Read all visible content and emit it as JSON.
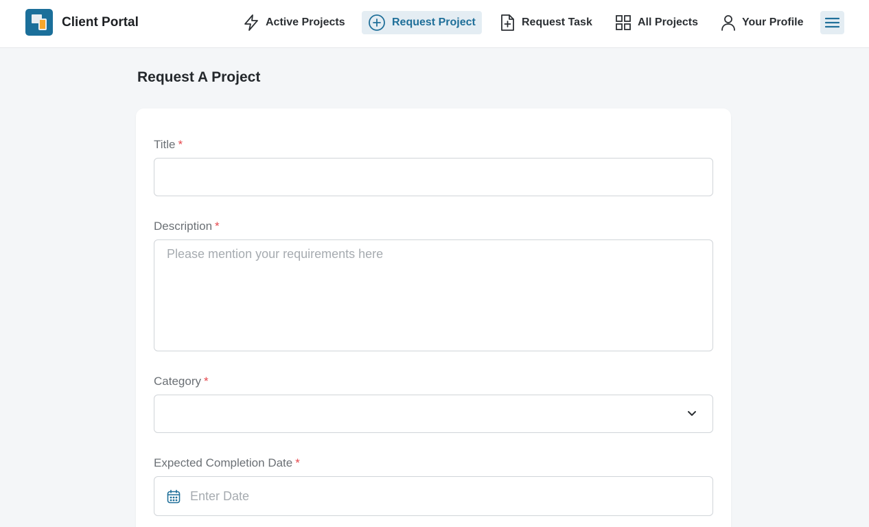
{
  "brand": {
    "name": "Client Portal"
  },
  "nav": [
    {
      "label": "Active Projects",
      "icon": "lightning-icon",
      "active": false
    },
    {
      "label": "Request Project",
      "icon": "plus-circle-icon",
      "active": true
    },
    {
      "label": "Request Task",
      "icon": "file-plus-icon",
      "active": false
    },
    {
      "label": "All Projects",
      "icon": "grid-icon",
      "active": false
    },
    {
      "label": "Your Profile",
      "icon": "user-icon",
      "active": false
    }
  ],
  "page": {
    "title": "Request A Project"
  },
  "form": {
    "title": {
      "label": "Title",
      "required_mark": "*",
      "value": "",
      "placeholder": ""
    },
    "description": {
      "label": "Description",
      "required_mark": "*",
      "value": "",
      "placeholder": "Please mention your requirements here"
    },
    "category": {
      "label": "Category",
      "required_mark": "*",
      "value": ""
    },
    "completion_date": {
      "label": "Expected Completion Date",
      "required_mark": "*",
      "value": "",
      "placeholder": "Enter Date"
    }
  },
  "colors": {
    "accent": "#1f6f99",
    "required": "#e5484d",
    "active_bg": "#e4edf3"
  }
}
